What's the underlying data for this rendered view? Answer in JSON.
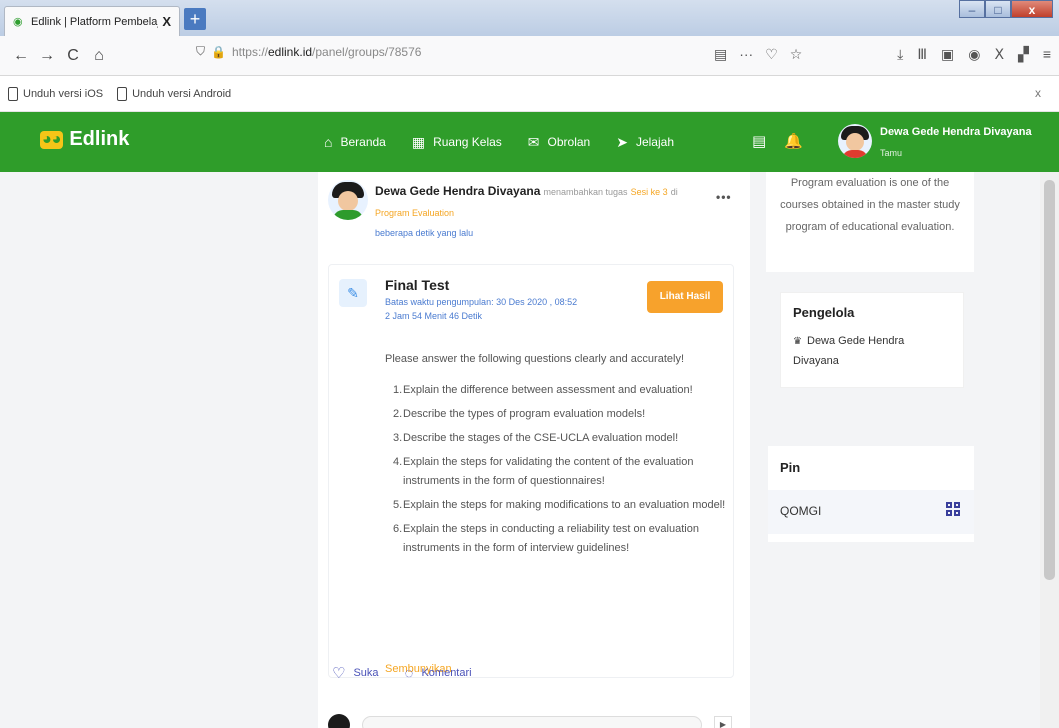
{
  "browser": {
    "tab_title": "Edlink | Platform Pembelajaran",
    "tab_close": "X",
    "new_tab": "+",
    "window_controls": {
      "minimize": "–",
      "maximize": "□",
      "close": "x"
    },
    "nav": {
      "back": "←",
      "forward": "→",
      "reload": "C",
      "home": "⌂"
    },
    "url_prefix": "https://",
    "url_domain": "edlink.id",
    "url_path": "/panel/groups/78576"
  },
  "app_bar": {
    "ios_label": "Unduh versi iOS",
    "android_label": "Unduh versi Android",
    "close_label": "x"
  },
  "header": {
    "logo_text": "Edlink",
    "menu": [
      {
        "label": "Beranda",
        "icon": "home-icon",
        "glyph": "⌂"
      },
      {
        "label": "Ruang Kelas",
        "icon": "classroom-icon",
        "glyph": "▦"
      },
      {
        "label": "Obrolan",
        "icon": "chat-icon",
        "glyph": "✉"
      },
      {
        "label": "Jelajah",
        "icon": "explore-icon",
        "glyph": "➤"
      }
    ],
    "user_name": "Dewa Gede Hendra Divayana",
    "user_role": "Tamu"
  },
  "post": {
    "author": "Dewa Gede Hendra Divayana",
    "action": "menambahkan tugas",
    "session": "Sesi ke 3",
    "preposition": "di",
    "course": "Program Evaluation",
    "time": "beberapa detik yang lalu",
    "more": "•••",
    "task": {
      "title": "Final Test",
      "deadline": "Batas waktu pengumpulan: 30 Des 2020 , 08:52",
      "countdown": "2 Jam 54 Menit 46 Detik",
      "result_button": "Lihat Hasil",
      "intro": "Please answer the following questions clearly and accurately!",
      "questions": [
        {
          "num": "1.",
          "text": "Explain the difference between assessment and evaluation!"
        },
        {
          "num": "2.",
          "text": "Describe the types of program evaluation models!"
        },
        {
          "num": "3.",
          "text": "Describe the stages of the CSE-UCLA evaluation model!"
        },
        {
          "num": "4.",
          "text": "Explain the steps for validating the content of the evaluation instruments in the form of questionnaires!"
        },
        {
          "num": "5.",
          "text": "Explain the steps for making modifications to an evaluation model!"
        },
        {
          "num": "6.",
          "text": "Explain the steps in conducting a reliability test on evaluation instruments in the form of interview guidelines!"
        }
      ],
      "hide_label": "Sembunyikan"
    },
    "like_label": "Suka",
    "comment_label": "Komentari"
  },
  "sidebar": {
    "description": "Program evaluation is one of the courses obtained in the master study program of educational evaluation.",
    "manager_title": "Pengelola",
    "manager_name": "Dewa Gede Hendra Divayana",
    "pin_title": "Pin",
    "pin_code": "QOMGI"
  },
  "colors": {
    "header_green": "#2f9d2a",
    "accent_orange": "#f7a22c",
    "link_blue": "#4a7bd0"
  }
}
